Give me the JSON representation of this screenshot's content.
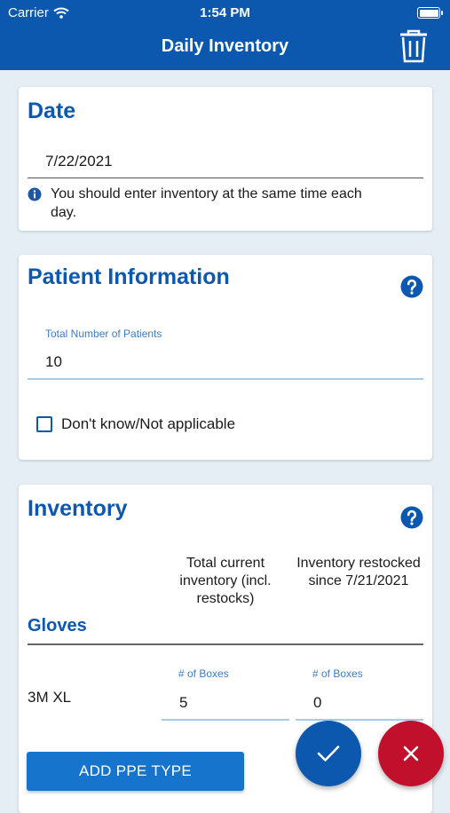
{
  "status_bar": {
    "carrier": "Carrier",
    "time": "1:54 PM"
  },
  "nav": {
    "title": "Daily Inventory",
    "delete_icon": "trash-icon"
  },
  "date_card": {
    "title": "Date",
    "value": "7/22/2021",
    "info_text": "You should enter inventory at the same time each day."
  },
  "patient_card": {
    "title": "Patient Information",
    "field_label": "Total Number of Patients",
    "field_value": "10",
    "checkbox_label": "Don't know/Not applicable",
    "checkbox_checked": false
  },
  "inventory_card": {
    "title": "Inventory",
    "col_current": "Total current inventory (incl. restocks)",
    "col_restocked": "Inventory restocked since 7/21/2021",
    "section": "Gloves",
    "items": [
      {
        "name": "3M XL",
        "current_label": "# of Boxes",
        "current_value": "5",
        "restocked_label": "# of Boxes",
        "restocked_value": "0"
      }
    ],
    "add_button": "ADD PPE TYPE"
  },
  "actions": {
    "confirm_icon": "check-icon",
    "cancel_icon": "close-icon"
  },
  "colors": {
    "primary": "#0b58ae",
    "danger": "#c0102b",
    "background": "#e5eef4"
  }
}
